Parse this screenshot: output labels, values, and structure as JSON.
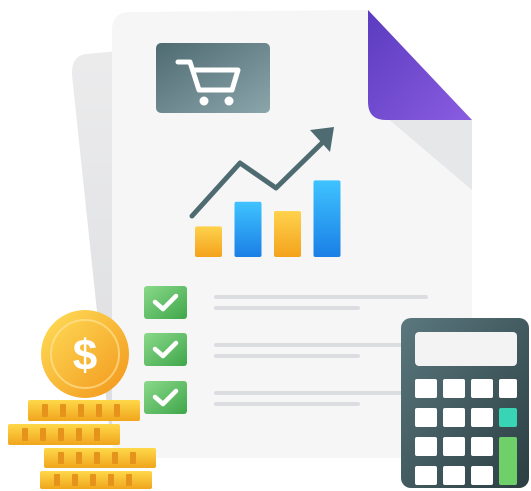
{
  "colors": {
    "paper_back": "#e6e7e8",
    "paper_front": "#f5f5f6",
    "paper_fold": "#e3e4e6",
    "corner_purple_start": "#5a3bbf",
    "corner_purple_end": "#8a5ce0",
    "cart_badge_start": "#4f6b72",
    "cart_badge_end": "#7b9aa0",
    "trend_arrow": "#4f6b72",
    "bar_orange_start": "#ffd24d",
    "bar_orange_end": "#f4a21c",
    "bar_blue_start": "#3fc3ff",
    "bar_blue_end": "#1a7fe6",
    "check_green_start": "#7bd37a",
    "check_green_end": "#3fa64a",
    "text_line": "#d9dadd",
    "coin_start": "#ffd84a",
    "coin_end": "#f39c1a",
    "calculator_start": "#4e6a70",
    "calculator_end": "#2d4145",
    "calc_display": "#f2f2f2",
    "calc_key": "#ffffff",
    "calc_key_teal": "#39d3b5",
    "calc_key_green": "#6fd06a"
  },
  "icons": {
    "cart": "shopping-cart-icon",
    "chart": "bar-chart-icon",
    "trend": "trend-arrow-icon",
    "check": "checkmark-icon",
    "coin": "dollar-coin-icon",
    "calculator": "calculator-icon"
  },
  "coin_symbol": "$",
  "chart_data": {
    "type": "bar",
    "categories": [
      "",
      "",
      "",
      ""
    ],
    "values": [
      2,
      3.6,
      3,
      5
    ],
    "series_colors": [
      "orange",
      "blue",
      "orange",
      "blue"
    ],
    "ylim": [
      0,
      6
    ],
    "title": "",
    "xlabel": "",
    "ylabel": ""
  },
  "checklist": [
    {
      "checked": true
    },
    {
      "checked": true
    },
    {
      "checked": true
    }
  ]
}
